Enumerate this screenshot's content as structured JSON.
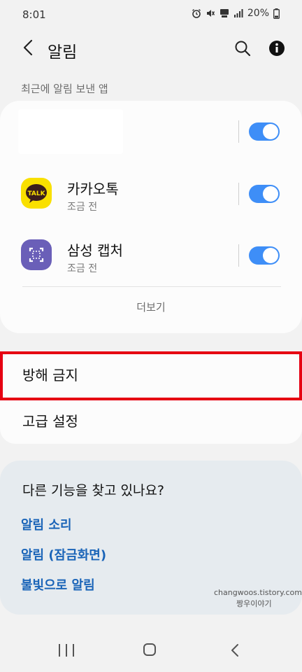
{
  "status": {
    "time": "8:01",
    "battery": "20%",
    "icons": [
      "alarm-icon",
      "mute-icon",
      "volte-icon",
      "signal-icon",
      "battery-icon"
    ]
  },
  "header": {
    "title": "알림",
    "back_icon": "chevron-left-icon",
    "search_icon": "search-icon",
    "info_icon": "info-icon"
  },
  "recent": {
    "section_label": "최근에 알림 보낸 앱",
    "apps": [
      {
        "name": "",
        "sub": "",
        "enabled": true,
        "icon": "blank"
      },
      {
        "name": "카카오톡",
        "sub": "조금 전",
        "enabled": true,
        "icon": "kakaotalk-icon",
        "icon_text": "TALK",
        "icon_color": "#f9e000"
      },
      {
        "name": "삼성 캡처",
        "sub": "조금 전",
        "enabled": true,
        "icon": "samsung-capture-icon",
        "icon_color": "#6a5fb8"
      }
    ],
    "more_label": "더보기"
  },
  "settings": {
    "dnd_label": "방해 금지",
    "advanced_label": "고급 설정"
  },
  "more_features": {
    "title": "다른 기능을 찾고 있나요?",
    "links": [
      "알림 소리",
      "알림 (잠금화면)",
      "불빛으로 알림"
    ]
  },
  "watermark": {
    "line1": "changwoos.tistory.com",
    "line2": "짱우이야기"
  },
  "colors": {
    "accent": "#3e8ef7",
    "link": "#1a64b8",
    "highlight": "#e60012",
    "background": "#f2f2f2"
  }
}
